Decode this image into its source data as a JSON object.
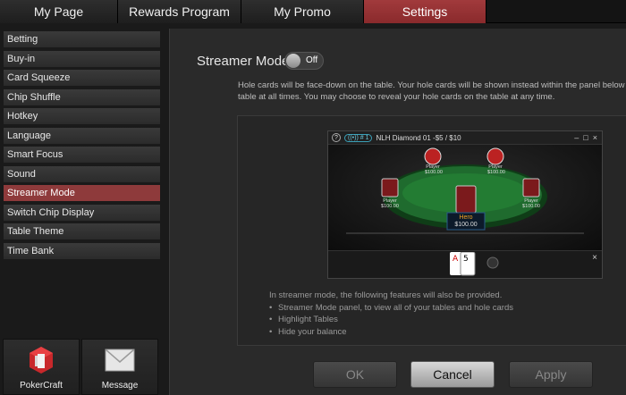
{
  "tabs": [
    {
      "label": "My Page",
      "active": false
    },
    {
      "label": "Rewards Program",
      "active": false
    },
    {
      "label": "My Promo",
      "active": false
    },
    {
      "label": "Settings",
      "active": true
    }
  ],
  "sidebar": {
    "items": [
      {
        "label": "Betting"
      },
      {
        "label": "Buy-in"
      },
      {
        "label": "Card Squeeze"
      },
      {
        "label": "Chip Shuffle"
      },
      {
        "label": "Hotkey"
      },
      {
        "label": "Language"
      },
      {
        "label": "Smart Focus"
      },
      {
        "label": "Sound"
      },
      {
        "label": "Streamer Mode",
        "active": true
      },
      {
        "label": "Switch Chip Display"
      },
      {
        "label": "Table Theme"
      },
      {
        "label": "Time Bank"
      }
    ],
    "bottom": [
      {
        "label": "PokerCraft",
        "icon": "pokercraft-icon"
      },
      {
        "label": "Message",
        "icon": "envelope-icon"
      }
    ]
  },
  "main": {
    "title": "Streamer Mode",
    "toggle": {
      "label": "Off",
      "on": false
    },
    "description": [
      "Hole cards will be face-down on the table. Your hole cards will be shown instead within the panel below the",
      "table at all times. You may choose to reveal your hole cards on the table at any time."
    ],
    "preview": {
      "window_title": "NLH Diamond 01 -$5 / $10",
      "badge": "# 1",
      "players": [
        {
          "name": "Player",
          "stack": "$100.00"
        },
        {
          "name": "Player",
          "stack": "$100.00"
        },
        {
          "name": "Player",
          "stack": "$100.00"
        },
        {
          "name": "Player",
          "stack": "$100.00"
        }
      ],
      "hero": {
        "name": "Hero",
        "stack": "$100.00"
      },
      "hole_cards": [
        "A",
        "5"
      ]
    },
    "features_intro": "In streamer mode, the following features will also be provided.",
    "features": [
      "Streamer Mode panel, to view all of your tables and hole cards",
      "Highlight Tables",
      "Hide your balance"
    ]
  },
  "actions": {
    "ok": "OK",
    "cancel": "Cancel",
    "apply": "Apply"
  },
  "colors": {
    "accent": "#8e3a3b",
    "felt": "#1f6b2e"
  }
}
